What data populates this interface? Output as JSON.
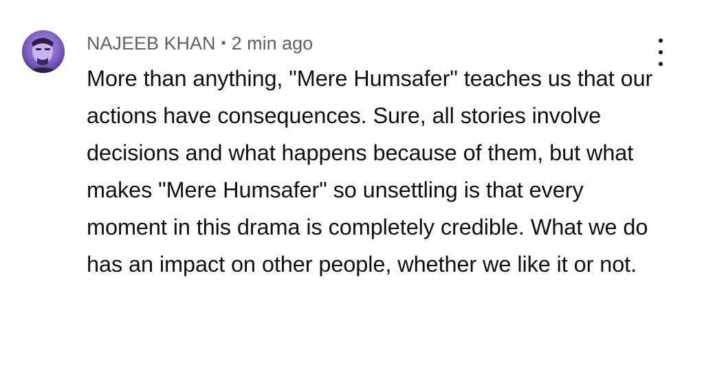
{
  "comment": {
    "author": "NAJEEB KHAN",
    "separator": "•",
    "timestamp": "2 min ago",
    "text": "More than anything, \"Mere Humsafer\" teaches us that our actions have consequences. Sure, all stories involve decisions and what happens because of them, but what makes \"Mere Humsafer\" so unsettling is that every moment in this drama is completely credible. What we do has an impact on other people, whether we like it or not.",
    "menu_icon": "more-vert-icon",
    "avatar_icon": "avatar"
  },
  "colors": {
    "meta_text": "#606060",
    "body_text": "#0f0f0f",
    "avatar_bg": "#6a4fb0"
  }
}
